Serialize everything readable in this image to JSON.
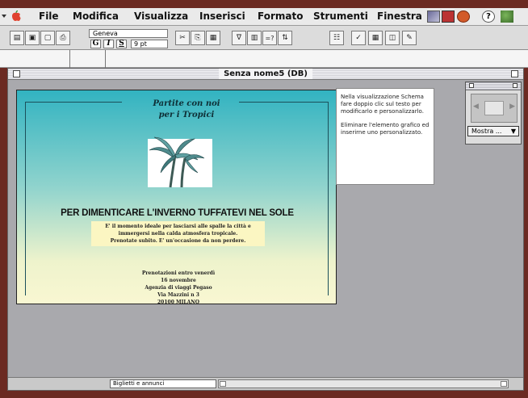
{
  "menubar": {
    "items": [
      "File",
      "Modifica",
      "Visualizza",
      "Inserisci",
      "Formato",
      "Strumenti",
      "Finestra"
    ]
  },
  "toolbar": {
    "font": "Geneva",
    "style_buttons": [
      "G",
      "I",
      "S"
    ],
    "size": "9 pt"
  },
  "window": {
    "title": "Senza nome5 (DB)"
  },
  "flyer": {
    "headline_line1": "Partite con noi",
    "headline_line2": "per i Tropici",
    "heading": "PER DIMENTICARE L'INVERNO TUFFATEVI NEL SOLE",
    "body_line1": "E' il momento ideale per lasciarsi alle spalle la città e",
    "body_line2": "immergersi nella calda atmosfera tropicale.",
    "body_line3": "Prenotate subito. E' un'occasione da non perdere.",
    "contact_line1": "Prenotazioni entro venerdì",
    "contact_line2": "16 novembre",
    "contact_line3": "Agenzia di viaggi Pegaso",
    "contact_line4": "Via Mazzini n 3",
    "contact_line5": "20100 MILANO"
  },
  "tip": {
    "paragraph1": "Nella visualizzazione Schema fare doppio clic sul testo per modificarlo e personalizzarlo.",
    "paragraph2": "Eliminare l'elemento grafico ed inserirne uno personalizzato."
  },
  "palette": {
    "button_label": "Mostra ..."
  },
  "status": {
    "label": "Biglietti e annunci"
  },
  "colors": {
    "flyer_top": "#32b3c1",
    "flyer_bottom": "#f9f7d2",
    "window_bg": "#a9a9ad"
  }
}
